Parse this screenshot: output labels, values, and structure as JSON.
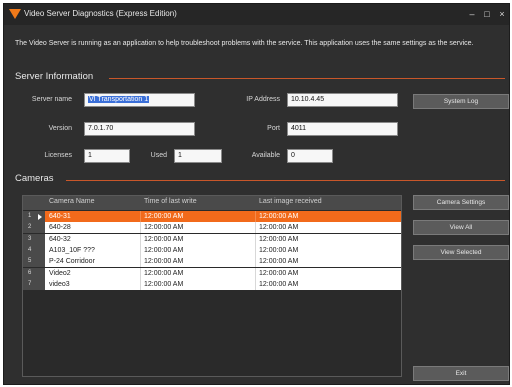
{
  "window": {
    "title": "Video Server Diagnostics (Express Edition)",
    "minimize": "–",
    "maximize": "□",
    "close": "×"
  },
  "description": "The Video Server is running as an application to help troubleshoot problems with the service.  This application uses the same settings as the service.",
  "server_info": {
    "heading": "Server Information",
    "server_name_label": "Server name",
    "server_name_value": "VI Transportation 1",
    "ip_address_label": "IP Address",
    "ip_address_value": "10.10.4.45",
    "version_label": "Version",
    "version_value": "7.0.1.70",
    "port_label": "Port",
    "port_value": "4011",
    "licenses_label": "Licenses",
    "licenses_value": "1",
    "used_label": "Used",
    "used_value": "1",
    "available_label": "Available",
    "available_value": "0",
    "system_log_button": "System Log"
  },
  "cameras": {
    "heading": "Cameras",
    "columns": [
      "Camera Name",
      "Time of last write",
      "Last image received"
    ],
    "rows": [
      {
        "num": "1",
        "name": "640-31",
        "last_write": "12:00:00 AM",
        "last_image": "12:00:00 AM"
      },
      {
        "num": "2",
        "name": "640-28",
        "last_write": "12:00:00 AM",
        "last_image": "12:00:00 AM"
      },
      {
        "num": "3",
        "name": "640-32",
        "last_write": "12:00:00 AM",
        "last_image": "12:00:00 AM"
      },
      {
        "num": "4",
        "name": "A103_10F ???",
        "last_write": "12:00:00 AM",
        "last_image": "12:00:00 AM"
      },
      {
        "num": "5",
        "name": "P-24 Corridoor",
        "last_write": "12:00:00 AM",
        "last_image": "12:00:00 AM"
      },
      {
        "num": "6",
        "name": "Video2",
        "last_write": "12:00:00 AM",
        "last_image": "12:00:00 AM"
      },
      {
        "num": "7",
        "name": "video3",
        "last_write": "12:00:00 AM",
        "last_image": "12:00:00 AM"
      }
    ],
    "selected_row": 0,
    "camera_settings_button": "Camera Settings",
    "view_all_button": "View All",
    "view_selected_button": "View Selected"
  },
  "exit_button": "Exit",
  "colors": {
    "accent": "#f26a1b",
    "background": "#2f2f2f",
    "section_line": "#c9572a"
  }
}
